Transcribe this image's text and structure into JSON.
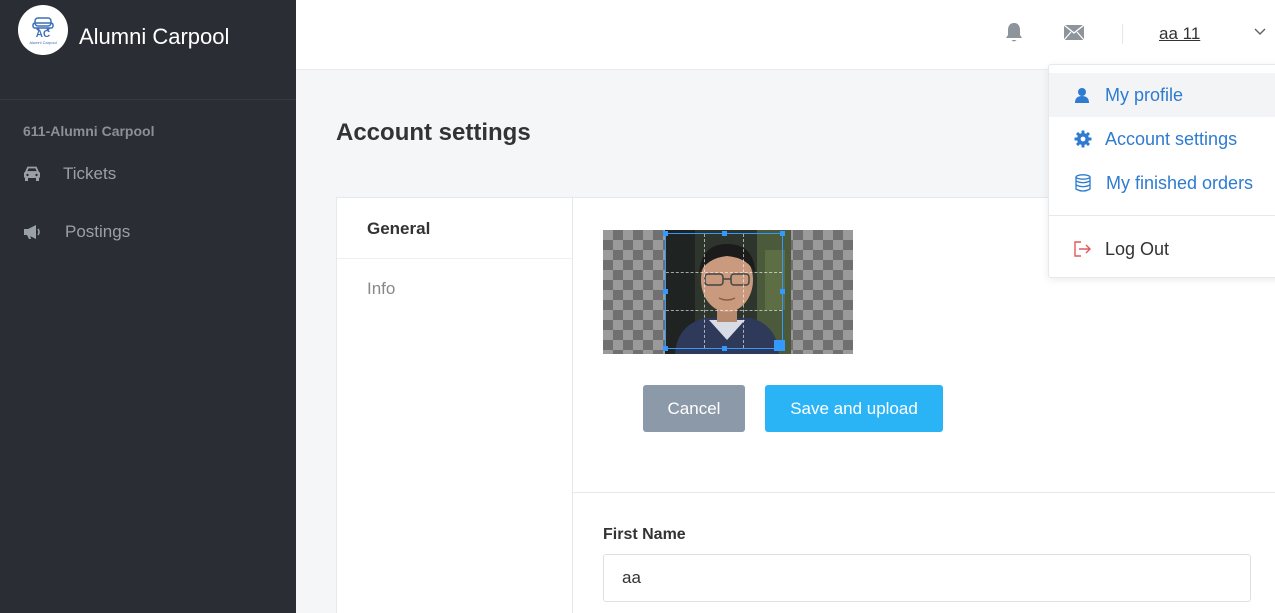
{
  "brand": {
    "name": "Alumni Carpool",
    "logo_text": "AC",
    "logo_subtext": "Alumni Carpool"
  },
  "sidebar": {
    "org": "611-Alumni Carpool",
    "items": [
      {
        "label": "Tickets",
        "icon": "car-icon"
      },
      {
        "label": "Postings",
        "icon": "megaphone-icon"
      }
    ]
  },
  "topbar": {
    "username": "aa 11",
    "icons": [
      "bell-icon",
      "mail-icon",
      "chevron-down-icon"
    ]
  },
  "page": {
    "title": "Account settings"
  },
  "tabs": [
    {
      "label": "General",
      "active": true
    },
    {
      "label": "Info",
      "active": false
    }
  ],
  "avatar_editor": {
    "cancel_label": "Cancel",
    "save_label": "Save and upload"
  },
  "form": {
    "first_name_label": "First Name",
    "first_name_value": "aa"
  },
  "user_menu": {
    "items": [
      {
        "label": "My profile",
        "icon": "user-icon"
      },
      {
        "label": "Account settings",
        "icon": "gear-icon"
      },
      {
        "label": "My finished orders",
        "icon": "database-icon"
      },
      {
        "label": "Log Out",
        "icon": "logout-icon"
      }
    ]
  },
  "colors": {
    "sidebar": "#2a2d33",
    "accent": "#2bb4f5",
    "link": "#2e7bd1",
    "cancel": "#8c99a9",
    "logout": "#e05a5a"
  }
}
